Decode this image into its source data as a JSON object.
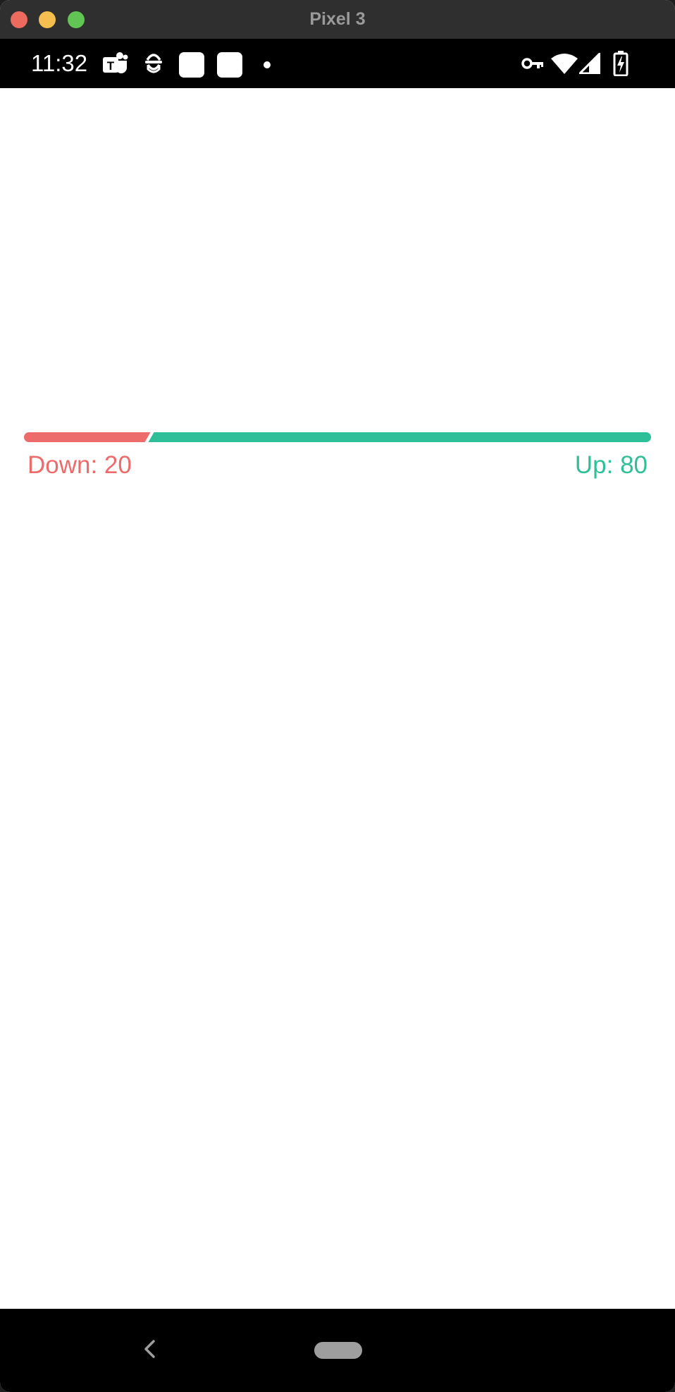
{
  "window": {
    "title": "Pixel 3",
    "controls": {
      "close_color": "#ed6a5e",
      "minimize_color": "#f5bf4f",
      "maximize_color": "#61c554"
    }
  },
  "status_bar": {
    "time": "11:32",
    "left_icons": [
      "teams-icon",
      "spy-icon",
      "app-square-icon",
      "app-square-icon",
      "notification-dot-icon"
    ],
    "right_icons": [
      "vpn-key-icon",
      "wifi-icon",
      "cell-signal-icon",
      "battery-charging-icon"
    ]
  },
  "ratio": {
    "down": 20,
    "up": 80,
    "down_label": "Down: 20",
    "up_label": "Up: 80",
    "down_fraction": 0.2,
    "down_color": "#ee6b6b",
    "up_color": "#2ebf99"
  },
  "nav_bar": {
    "buttons": [
      "back-icon",
      "home-pill"
    ]
  }
}
